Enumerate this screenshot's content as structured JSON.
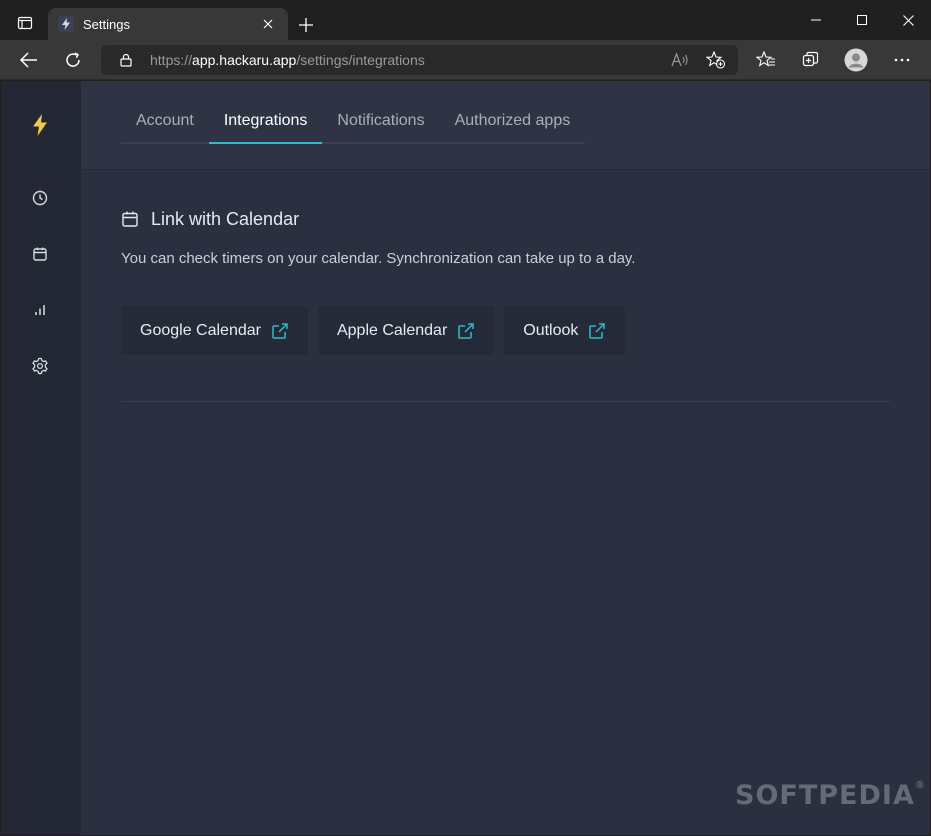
{
  "browser": {
    "tab_title": "Settings",
    "url_prefix": "https://",
    "url_host": "app.hackaru.app",
    "url_path": "/settings/integrations"
  },
  "sidebar": {
    "items": [
      {
        "name": "logo",
        "icon": "bolt-icon"
      },
      {
        "name": "timers",
        "icon": "clock-icon"
      },
      {
        "name": "calendar",
        "icon": "calendar-icon"
      },
      {
        "name": "reports",
        "icon": "bar-chart-icon"
      },
      {
        "name": "settings",
        "icon": "gear-icon"
      }
    ]
  },
  "tabs": [
    {
      "label": "Account",
      "active": false
    },
    {
      "label": "Integrations",
      "active": true
    },
    {
      "label": "Notifications",
      "active": false
    },
    {
      "label": "Authorized apps",
      "active": false
    }
  ],
  "section": {
    "title": "Link with Calendar",
    "description": "You can check timers on your calendar. Synchronization can take up to a day.",
    "buttons": [
      {
        "label": "Google Calendar"
      },
      {
        "label": "Apple Calendar"
      },
      {
        "label": "Outlook"
      }
    ]
  },
  "watermark": {
    "text": "SOFTPEDIA",
    "mark": "®"
  },
  "colors": {
    "accent": "#35b9c7",
    "bolt": "#f2c94c",
    "app_bg": "#2b3040",
    "sidebar_bg": "#232733"
  }
}
